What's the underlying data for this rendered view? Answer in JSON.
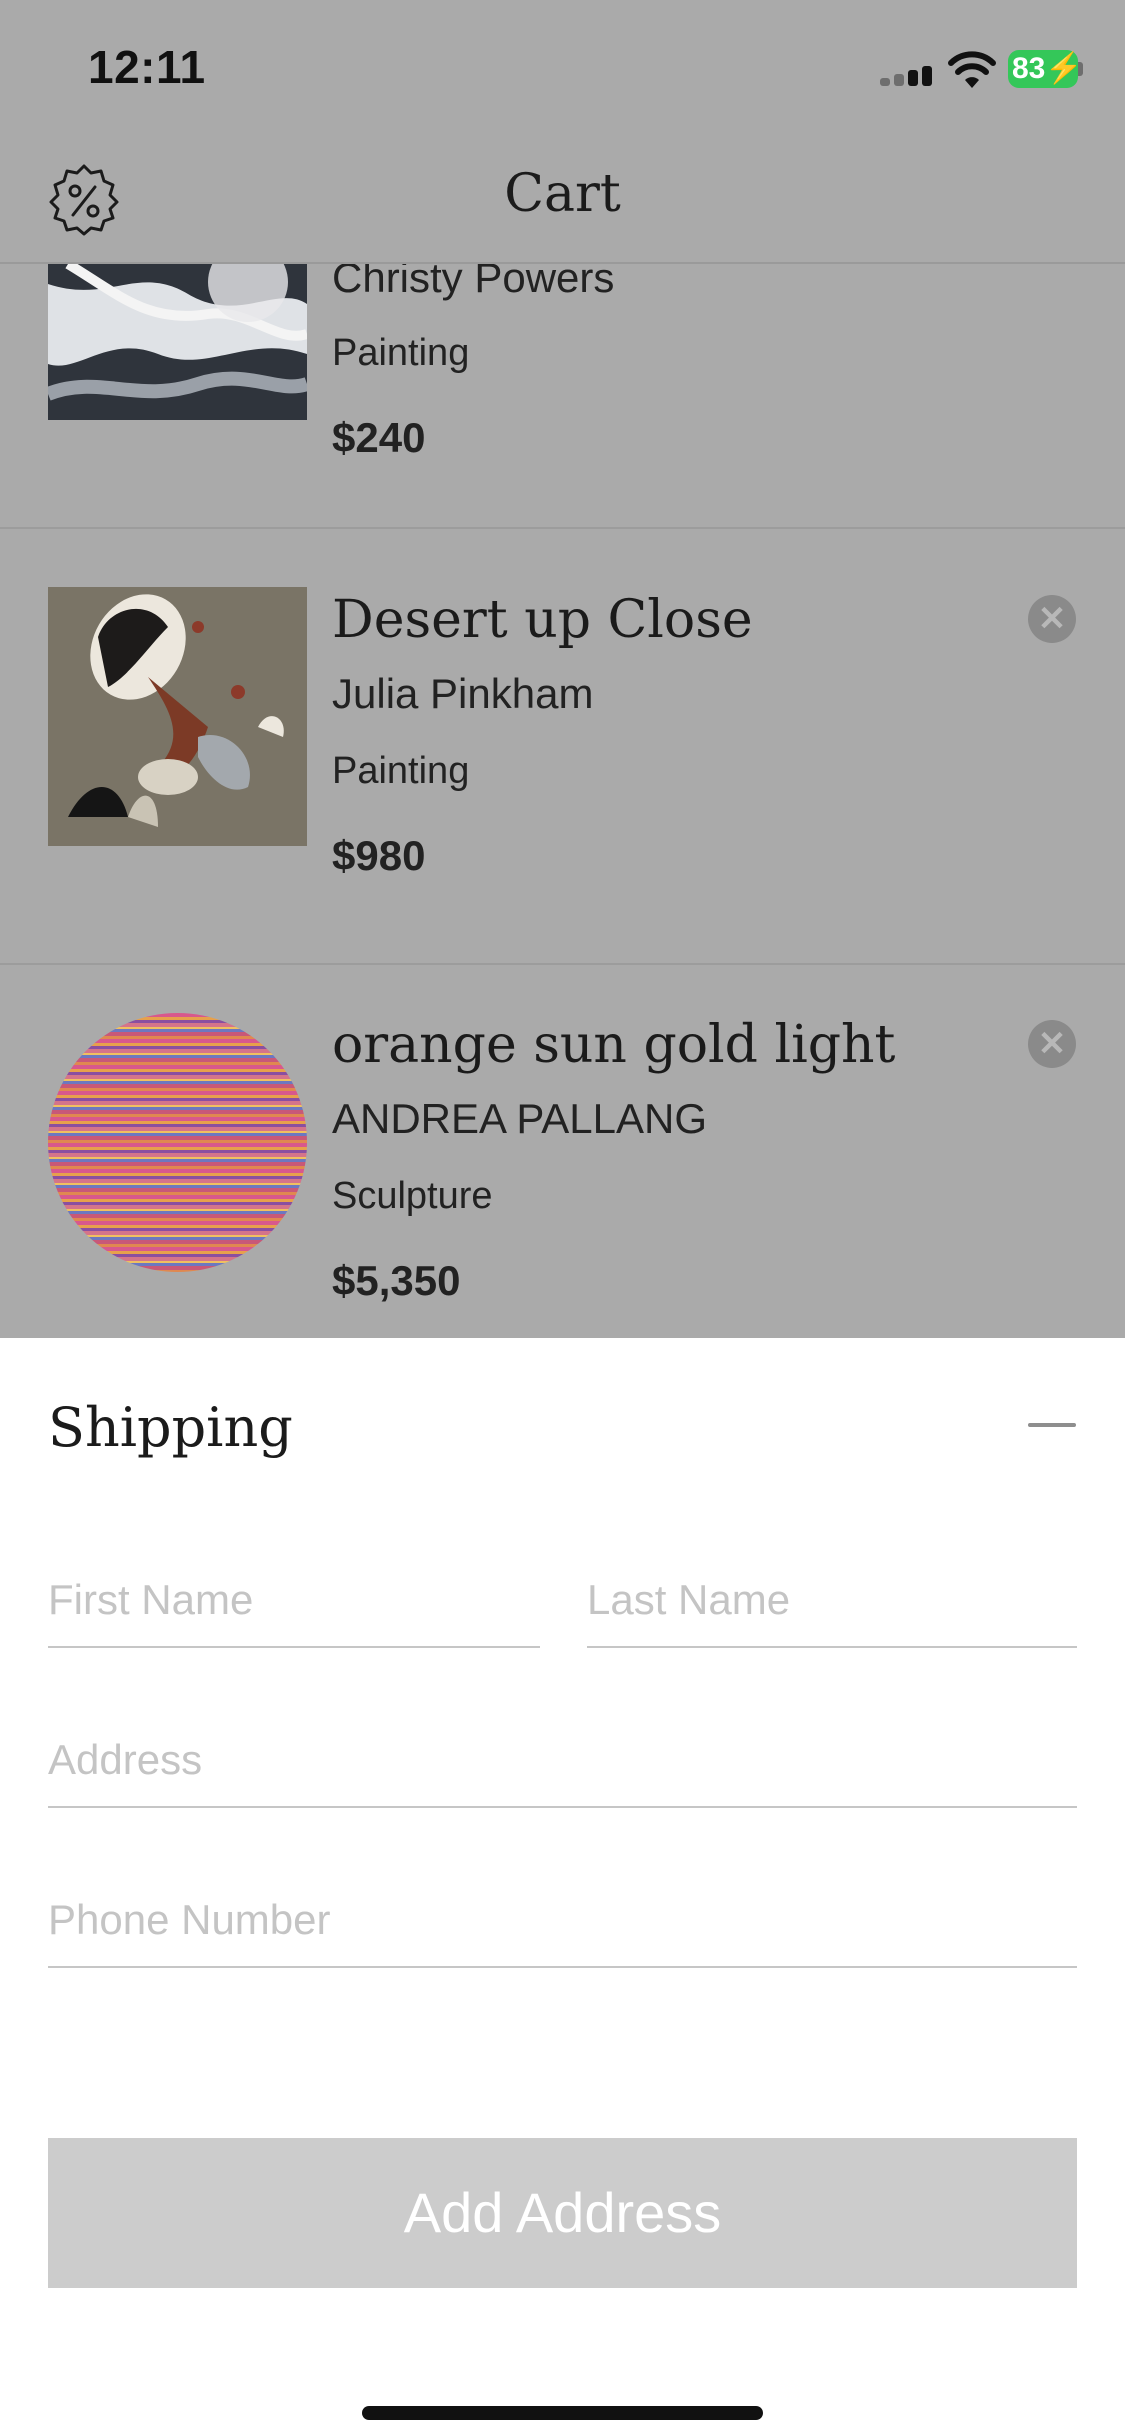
{
  "status_bar": {
    "time": "12:11",
    "battery": "83"
  },
  "nav": {
    "title": "Cart",
    "promo_icon": "percent-badge-icon"
  },
  "cart_items": [
    {
      "title": "",
      "artist": "Christy Powers",
      "category": "Painting",
      "price": "$240"
    },
    {
      "title": "Desert up Close",
      "artist": "Julia Pinkham",
      "category": "Painting",
      "price": "$980"
    },
    {
      "title": "orange sun gold light",
      "artist": "ANDREA PALLANG",
      "category": "Sculpture",
      "price": "$5,350"
    }
  ],
  "shipping": {
    "title": "Shipping",
    "first_name_placeholder": "First Name",
    "last_name_placeholder": "Last Name",
    "address_placeholder": "Address",
    "phone_placeholder": "Phone Number",
    "add_button_label": "Add Address"
  },
  "colors": {
    "battery": "#34c759",
    "dim_overlay": "#aaaaaa",
    "button_disabled": "#cccccc"
  }
}
